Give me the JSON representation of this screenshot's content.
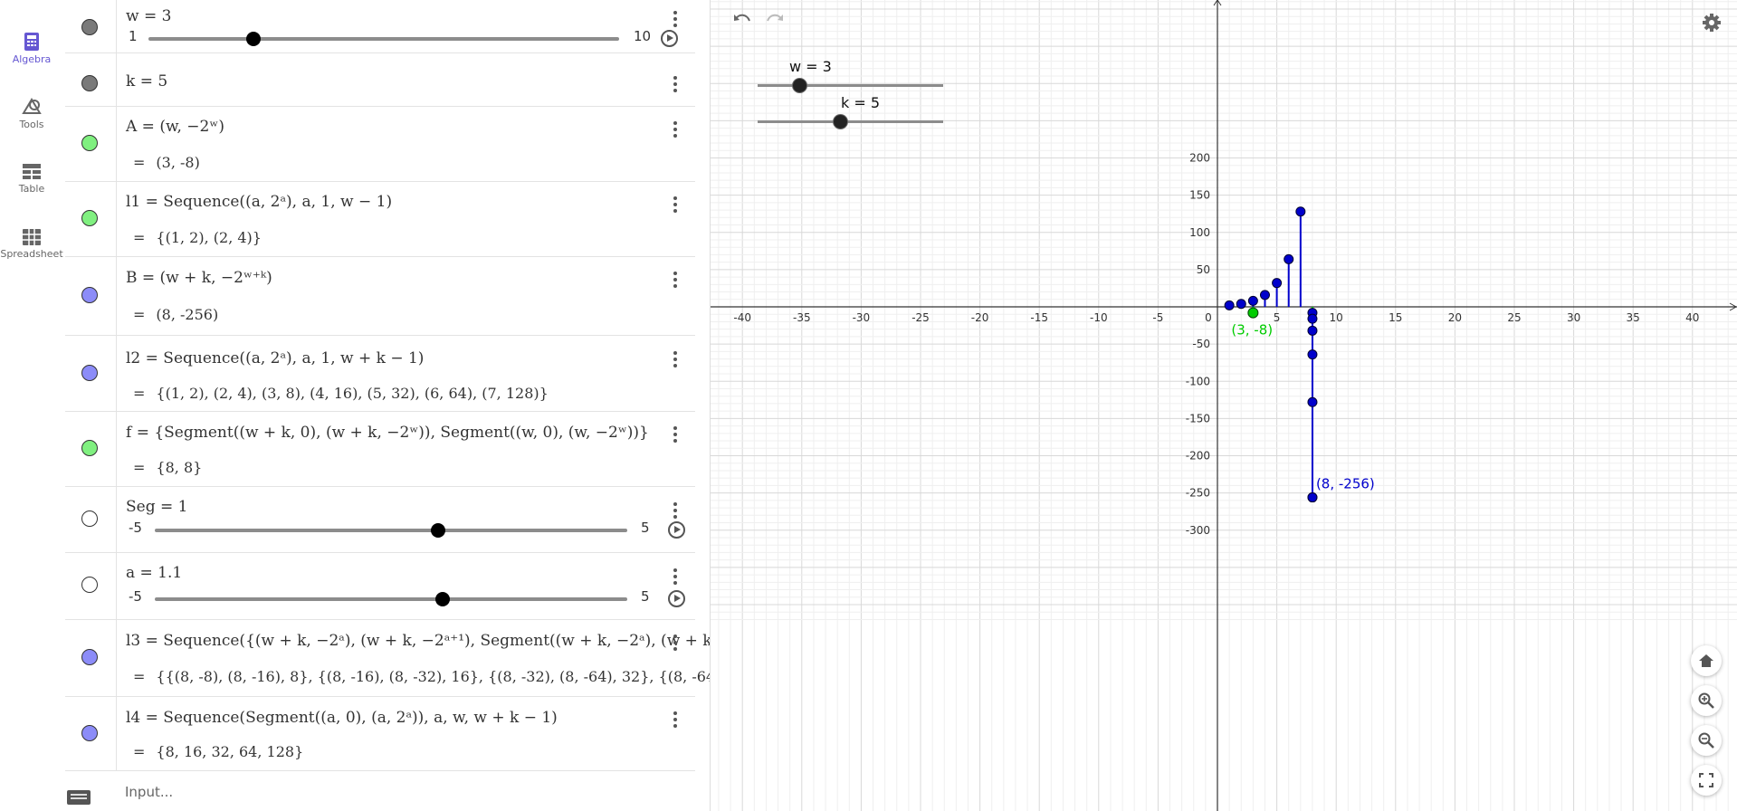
{
  "nav": {
    "items": [
      {
        "label": "Algebra",
        "icon": "calculator-icon",
        "active": true
      },
      {
        "label": "Tools",
        "icon": "shapes-icon",
        "active": false
      },
      {
        "label": "Table",
        "icon": "table-icon",
        "active": false
      },
      {
        "label": "Spreadsheet",
        "icon": "spreadsheet-icon",
        "active": false
      }
    ]
  },
  "algebra": {
    "rows": [
      {
        "id": "w",
        "def": "w = 3",
        "marble_color": "#7a7a7a",
        "slider": {
          "min": "1",
          "max": "10",
          "value": 3,
          "range": [
            1,
            10
          ]
        }
      },
      {
        "id": "k",
        "def": "k = 5",
        "marble_color": "#7a7a7a"
      },
      {
        "id": "A",
        "def": "A = (w, −2ʷ)",
        "value": "(3, -8)",
        "marble_color": "#80f080"
      },
      {
        "id": "l1",
        "def": "l1 = Sequence((a, 2ᵃ), a, 1, w − 1)",
        "value": "{(1, 2), (2, 4)}",
        "marble_color": "#80f080"
      },
      {
        "id": "B",
        "def": "B = (w + k, −2ʷ⁺ᵏ)",
        "value": "(8, -256)",
        "marble_color": "#8c8cf8"
      },
      {
        "id": "l2",
        "def": "l2 = Sequence((a, 2ᵃ), a, 1, w + k − 1)",
        "value": "{(1, 2), (2, 4), (3, 8), (4, 16), (5, 32), (6, 64), (7, 128)}",
        "marble_color": "#8c8cf8"
      },
      {
        "id": "f",
        "def": "f = {Segment((w + k, 0), (w + k, −2ʷ)), Segment((w, 0), (w, −2ʷ))}",
        "value": "{8, 8}",
        "marble_color": "#80f080"
      },
      {
        "id": "Seg",
        "def": "Seg = 1",
        "marble_color": "#ffffff",
        "slider": {
          "min": "-5",
          "max": "5",
          "value": 1,
          "range": [
            -5,
            5
          ]
        }
      },
      {
        "id": "a",
        "def": "a = 1.1",
        "marble_color": "#ffffff",
        "slider": {
          "min": "-5",
          "max": "5",
          "value": 1.1,
          "range": [
            -5,
            5
          ]
        }
      },
      {
        "id": "l3",
        "def": "l3 = Sequence({(w + k, −2ᵃ), (w + k, −2ᵃ⁺¹), Segment((w + k, −2ᵃ), (w + k, −2ᵃ⁺",
        "value": "{{(8, -8), (8, -16), 8}, {(8, -16), (8, -32), 16}, {(8, -32), (8, -64), 32}, {(8, -64), (8, -128),",
        "marble_color": "#8c8cf8"
      },
      {
        "id": "l4",
        "def": "l4 = Sequence(Segment((a, 0), (a, 2ᵃ)), a, w, w + k − 1)",
        "value": "{8, 16, 32, 64, 128}",
        "marble_color": "#8c8cf8"
      }
    ],
    "input_placeholder": "Input..."
  },
  "graphics": {
    "sliders": [
      {
        "label": "w = 3",
        "value": 3,
        "range": [
          1,
          10
        ]
      },
      {
        "label": "k = 5",
        "value": 5,
        "range": [
          1,
          10
        ]
      }
    ],
    "x_ticks": [
      "-40",
      "-35",
      "-30",
      "-25",
      "-20",
      "-15",
      "-10",
      "-5",
      "0",
      "5",
      "10",
      "15",
      "20",
      "25",
      "30",
      "35",
      "40"
    ],
    "y_ticks": [
      "200",
      "150",
      "100",
      "50",
      "-50",
      "-100",
      "-150",
      "-200",
      "-250",
      "-300"
    ],
    "x_tick_values": [
      -40,
      -35,
      -30,
      -25,
      -20,
      -15,
      -10,
      -5,
      0,
      5,
      10,
      15,
      20,
      25,
      30,
      35,
      40
    ],
    "y_tick_values": [
      200,
      150,
      100,
      50,
      -50,
      -100,
      -150,
      -200,
      -250,
      -300
    ],
    "point_A": {
      "x": 3,
      "y": -8,
      "label": "(3, -8)",
      "color": "#00cc00"
    },
    "point_B": {
      "x": 8,
      "y": -256,
      "label": "(8, -256)",
      "color": "#0000cc"
    },
    "l1_points": [
      [
        1,
        2
      ],
      [
        2,
        4
      ]
    ],
    "l2_points": [
      [
        1,
        2
      ],
      [
        2,
        4
      ],
      [
        3,
        8
      ],
      [
        4,
        16
      ],
      [
        5,
        32
      ],
      [
        6,
        64
      ],
      [
        7,
        128
      ]
    ],
    "l3_points": [
      [
        8,
        -8
      ],
      [
        8,
        -16
      ],
      [
        8,
        -32
      ],
      [
        8,
        -64
      ],
      [
        8,
        -128
      ],
      [
        8,
        -256
      ]
    ],
    "l4_segments": [
      3,
      4,
      5,
      6,
      7
    ],
    "f_segments": [
      8,
      3
    ],
    "seg_color": "#0000cc"
  },
  "colors": {
    "accent": "#6557d2",
    "blue": "#0000cc",
    "green": "#00cc00"
  }
}
